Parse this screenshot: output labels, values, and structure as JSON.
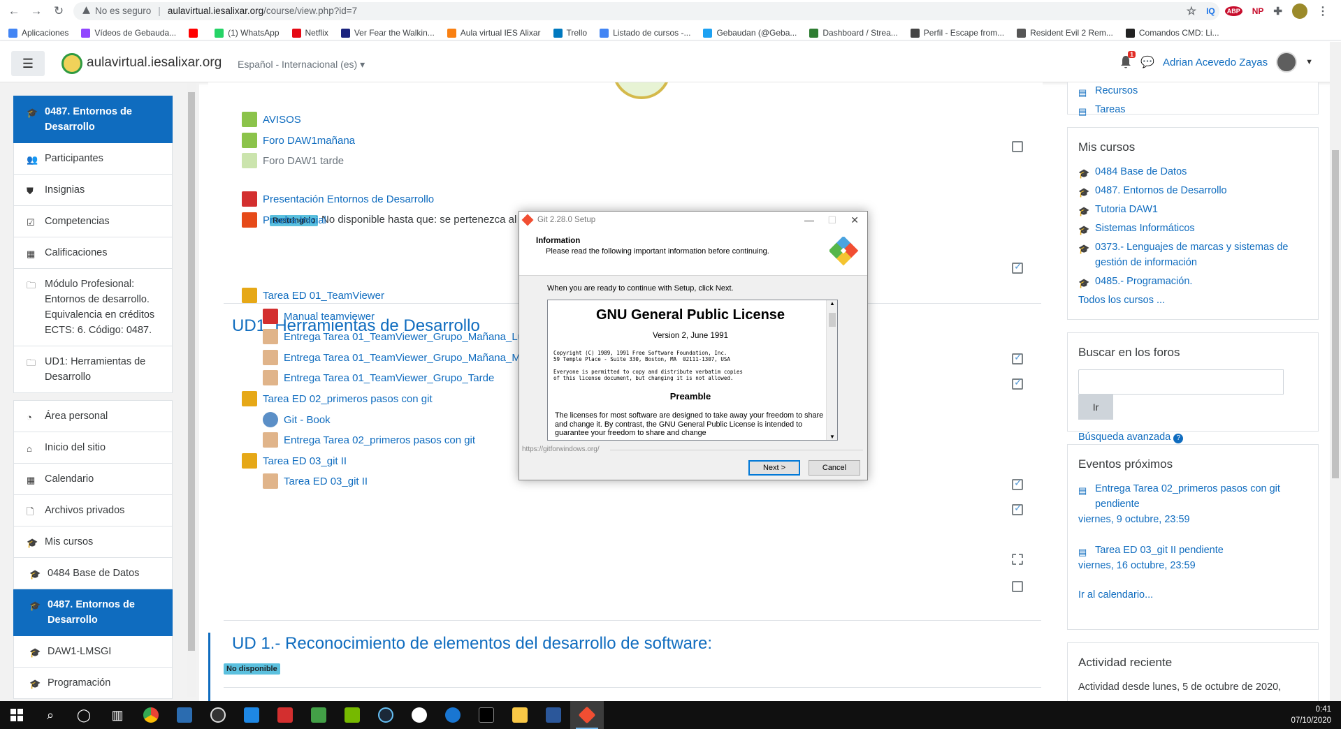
{
  "browser": {
    "security": "No es seguro",
    "url_host": "aulavirtual.iesalixar.org",
    "url_path": "/course/view.php?id=7",
    "extensions": [
      "IQ",
      "ABP",
      "NP"
    ],
    "bookmarks": [
      {
        "label": "Aplicaciones",
        "color": "#4285f4"
      },
      {
        "label": "Vídeos de Gebauda...",
        "color": "#9146ff"
      },
      {
        "label": "",
        "color": "#ff0000"
      },
      {
        "label": "(1) WhatsApp",
        "color": "#25d366"
      },
      {
        "label": "Netflix",
        "color": "#e50914"
      },
      {
        "label": "Ver Fear the Walkin...",
        "color": "#1a237e"
      },
      {
        "label": "Aula virtual IES Alixar",
        "color": "#f98012"
      },
      {
        "label": "Trello",
        "color": "#0079bf"
      },
      {
        "label": "Listado de cursos -...",
        "color": "#4285f4"
      },
      {
        "label": "Gebaudan (@Geba...",
        "color": "#1da1f2"
      },
      {
        "label": "Dashboard / Strea...",
        "color": "#2e7d32"
      },
      {
        "label": "Perfil - Escape from...",
        "color": "#444444"
      },
      {
        "label": "Resident Evil 2 Rem...",
        "color": "#555555"
      },
      {
        "label": "Comandos CMD: Li...",
        "color": "#222222"
      }
    ]
  },
  "navbar": {
    "site_name": "aulavirtual.iesalixar.org",
    "language": "Español - Internacional (es)",
    "notif_count": "1",
    "user_name": "Adrian Acevedo Zayas"
  },
  "drawer": {
    "items": [
      {
        "label": "0487. Entornos de Desarrollo",
        "icon": "graduation-cap-icon"
      },
      {
        "label": "Participantes",
        "icon": "users-icon"
      },
      {
        "label": "Insignias",
        "icon": "shield-icon"
      },
      {
        "label": "Competencias",
        "icon": "check-square-icon"
      },
      {
        "label": "Calificaciones",
        "icon": "table-icon"
      },
      {
        "label": "Módulo Profesional: Entornos de desarrollo. Equivalencia en créditos ECTS: 6. Código: 0487.",
        "icon": "folder-icon"
      },
      {
        "label": "UD1: Herramientas de Desarrollo",
        "icon": "folder-icon"
      },
      {
        "label": "Área personal",
        "icon": "dashboard-icon"
      },
      {
        "label": "Inicio del sitio",
        "icon": "home-icon"
      },
      {
        "label": "Calendario",
        "icon": "calendar-icon"
      },
      {
        "label": "Archivos privados",
        "icon": "file-icon"
      },
      {
        "label": "Mis cursos",
        "icon": "graduation-cap-icon"
      },
      {
        "label": "0484 Base de Datos",
        "icon": "graduation-cap-icon"
      },
      {
        "label": "0487. Entornos de Desarrollo",
        "icon": "graduation-cap-icon"
      },
      {
        "label": "DAW1-LMSGI",
        "icon": "graduation-cap-icon"
      },
      {
        "label": "Programación",
        "icon": "graduation-cap-icon"
      }
    ]
  },
  "main": {
    "activities": [
      {
        "label": "AVISOS",
        "icon": "forum-icon"
      },
      {
        "label": "Foro DAW1mañana",
        "icon": "forum-icon"
      },
      {
        "label": "Foro DAW1 tarde",
        "icon": "forum-icon"
      },
      {
        "label": "Presentación Entornos de Desarrollo",
        "icon": "pdf-icon"
      },
      {
        "label": "Prueba Inicial",
        "icon": "quiz-icon"
      },
      {
        "label": "Tarea ED 01_TeamViewer",
        "icon": "folder-box-icon"
      },
      {
        "label": "Manual teamviewer",
        "icon": "pdf-icon"
      },
      {
        "label": "Entrega Tarea 01_TeamViewer_Grupo_Mañana_Lu",
        "icon": "assignment-icon"
      },
      {
        "label": "Entrega Tarea 01_TeamViewer_Grupo_Mañana_Mi",
        "icon": "assignment-icon"
      },
      {
        "label": "Entrega Tarea 01_TeamViewer_Grupo_Tarde",
        "icon": "assignment-icon"
      },
      {
        "label": "Tarea ED 02_primeros pasos con git",
        "icon": "folder-box-icon"
      },
      {
        "label": "Git - Book",
        "icon": "url-icon"
      },
      {
        "label": "Entrega Tarea 02_primeros pasos con git",
        "icon": "assignment-icon"
      },
      {
        "label": "Tarea ED 03_git II",
        "icon": "folder-box-icon"
      },
      {
        "label": "Tarea ED 03_git II",
        "icon": "assignment-icon"
      }
    ],
    "restricted_badge": "Restringido",
    "restricted_text": "No disponible hasta que: se pertenezca al g",
    "section_ud1": "UD1: Herramientas de Desarrollo",
    "section_ud1b": "UD 1.- Reconocimiento de elementos del desarrollo de software:",
    "not_available_badge": "No disponible"
  },
  "right": {
    "top_links": [
      "Recursos",
      "Tareas"
    ],
    "my_courses_title": "Mis cursos",
    "my_courses": [
      "0484 Base de Datos",
      "0487. Entornos de Desarrollo",
      "Tutoria DAW1",
      "Sistemas Informáticos",
      "0373.- Lenguajes de marcas y sistemas de gestión de información",
      "0485.- Programación."
    ],
    "all_courses": "Todos los cursos ...",
    "search_title": "Buscar en los foros",
    "search_button": "Ir",
    "advanced_search": "Búsqueda avanzada",
    "events_title": "Eventos próximos",
    "events": [
      {
        "title": "Entrega Tarea 02_primeros pasos con git pendiente",
        "date": "viernes, 9 octubre, 23:59"
      },
      {
        "title": "Tarea ED 03_git II pendiente",
        "date": "viernes, 16 octubre, 23:59"
      }
    ],
    "calendar_link": "Ir al calendario...",
    "recent_title": "Actividad reciente",
    "recent_text": "Actividad desde lunes, 5 de octubre de 2020,"
  },
  "dialog": {
    "title": "Git 2.28.0 Setup",
    "heading": "Information",
    "subheading": "Please read the following important information before continuing.",
    "instruction": "When you are ready to continue with Setup, click Next.",
    "license_title": "GNU General Public License",
    "license_version": "Version 2, June 1991",
    "license_copyright": "Copyright (C) 1989, 1991 Free Software Foundation, Inc.\n59 Temple Place - Suite 330, Boston, MA  02111-1307, USA\n\nEveryone is permitted to copy and distribute verbatim copies\nof this license document, but changing it is not allowed.",
    "preamble": "Preamble",
    "preamble_text": "The licenses for most software are designed to take away your freedom to share and change it. By contrast, the GNU General Public License is intended to guarantee your freedom to share and change",
    "footer_url": "https://gitforwindows.org/",
    "next_button": "Next >",
    "cancel_button": "Cancel"
  },
  "taskbar": {
    "time": "0:41",
    "date": "07/10/2020"
  }
}
